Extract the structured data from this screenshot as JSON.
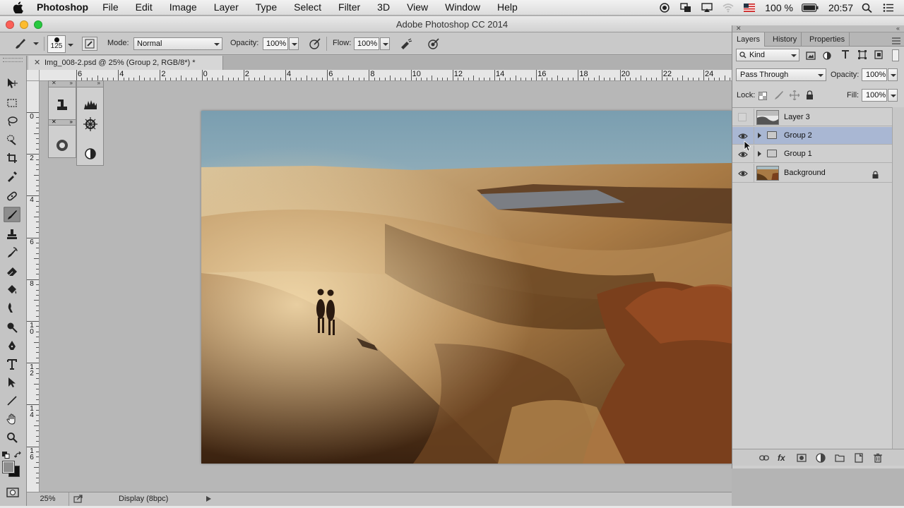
{
  "menubar": {
    "app_name": "Photoshop",
    "items": [
      "File",
      "Edit",
      "Image",
      "Layer",
      "Type",
      "Select",
      "Filter",
      "3D",
      "View",
      "Window",
      "Help"
    ],
    "battery": "100 %",
    "clock": "20:57"
  },
  "window": {
    "title": "Adobe Photoshop CC 2014"
  },
  "options": {
    "brush_size": "125",
    "mode_label": "Mode:",
    "mode_value": "Normal",
    "opacity_label": "Opacity:",
    "opacity_value": "100%",
    "flow_label": "Flow:",
    "flow_value": "100%"
  },
  "document": {
    "tab_title": "Img_008-2.psd @ 25% (Group 2, RGB/8*) *",
    "ruler_h_labels": [
      "6",
      "4",
      "2",
      "0",
      "2",
      "4",
      "6",
      "8",
      "10",
      "12",
      "14",
      "16",
      "18",
      "20",
      "22",
      "24"
    ],
    "ruler_v_labels": [
      "0",
      "2",
      "4",
      "6",
      "8",
      "10",
      "12",
      "14",
      "16"
    ]
  },
  "panel": {
    "tabs": [
      "Layers",
      "History",
      "Properties"
    ],
    "active_tab": "Layers",
    "filter_value": "Kind",
    "blend_mode": "Pass Through",
    "opacity_label": "Opacity:",
    "opacity_value": "100%",
    "lock_label": "Lock:",
    "fill_label": "Fill:",
    "fill_value": "100%",
    "layers": [
      {
        "name": "Layer 3",
        "type": "layer",
        "visible": false,
        "selected": false,
        "locked": false
      },
      {
        "name": "Group 2",
        "type": "group",
        "visible": true,
        "selected": true,
        "locked": false
      },
      {
        "name": "Group 1",
        "type": "group",
        "visible": true,
        "selected": false,
        "locked": false
      },
      {
        "name": "Background",
        "type": "layer",
        "visible": true,
        "selected": false,
        "locked": true
      }
    ]
  },
  "statusbar": {
    "zoom": "25%",
    "info": "Display (8bpc)"
  },
  "colors": {
    "selected_layer": "#a9b7d3",
    "panel_bg": "#cfcfcf",
    "canvas_bg": "#b7b7b7"
  }
}
